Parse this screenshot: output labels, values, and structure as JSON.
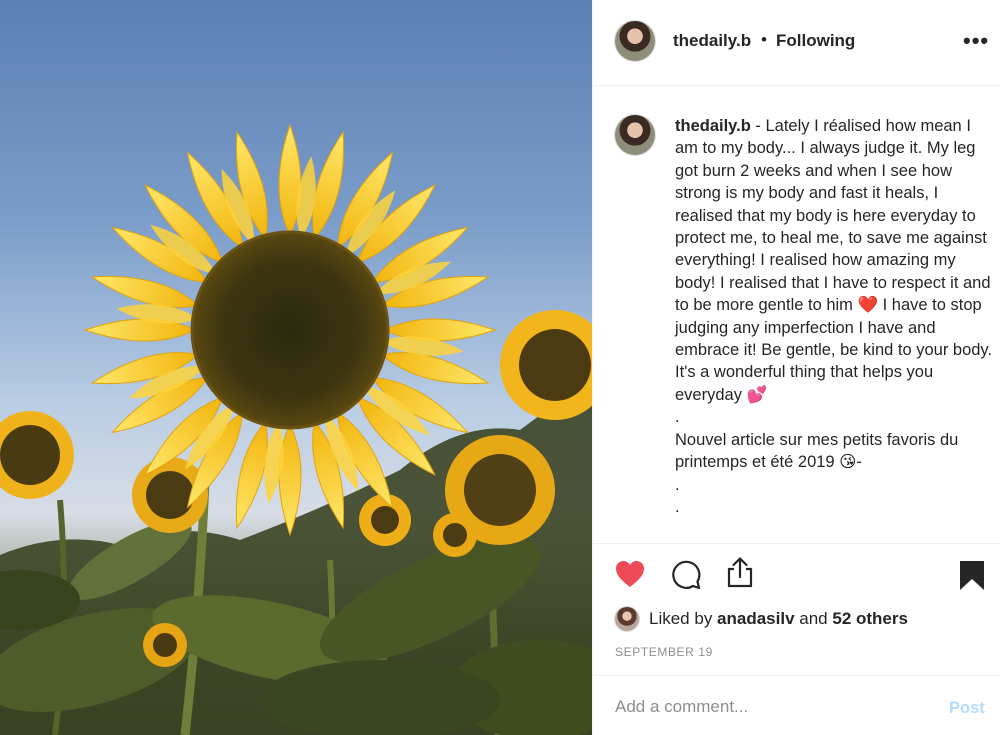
{
  "post": {
    "username": "thedaily.b",
    "separator": "•",
    "follow_status": "Following",
    "more_label": "•••"
  },
  "caption": {
    "username": "thedaily.b",
    "text": " - Lately I réalised how mean I am to my body... I always judge it. My leg got burn 2 weeks and when I see how strong is my body and fast it heals, I realised that my body is here everyday to protect me, to heal me, to save me against everything! I realised how amazing my body! I realised that I have to respect it and to be more gentle to him ❤️ I have to stop judging any imperfection I have and embrace it! Be gentle, be kind to your body. It's a wonderful thing that helps you everyday 💕",
    "dot1": ".",
    "line2": "Nouvel article sur mes petits favoris du printemps et été 2019 😘-",
    "dot2": ".",
    "dot3": "."
  },
  "likes": {
    "prefix": "Liked by ",
    "user": "anadasilv",
    "mid": " and ",
    "others": "52 others"
  },
  "date": "SEPTEMBER 19",
  "comment": {
    "placeholder": "Add a comment...",
    "post_label": "Post"
  },
  "icons": {
    "like": "heart-icon",
    "comment": "comment-icon",
    "share": "share-icon",
    "save": "bookmark-icon",
    "more": "more-icon"
  },
  "colors": {
    "liked_heart": "#ed4956",
    "post_button_disabled": "#b3dbff",
    "secondary_text": "#8e8e8e"
  }
}
